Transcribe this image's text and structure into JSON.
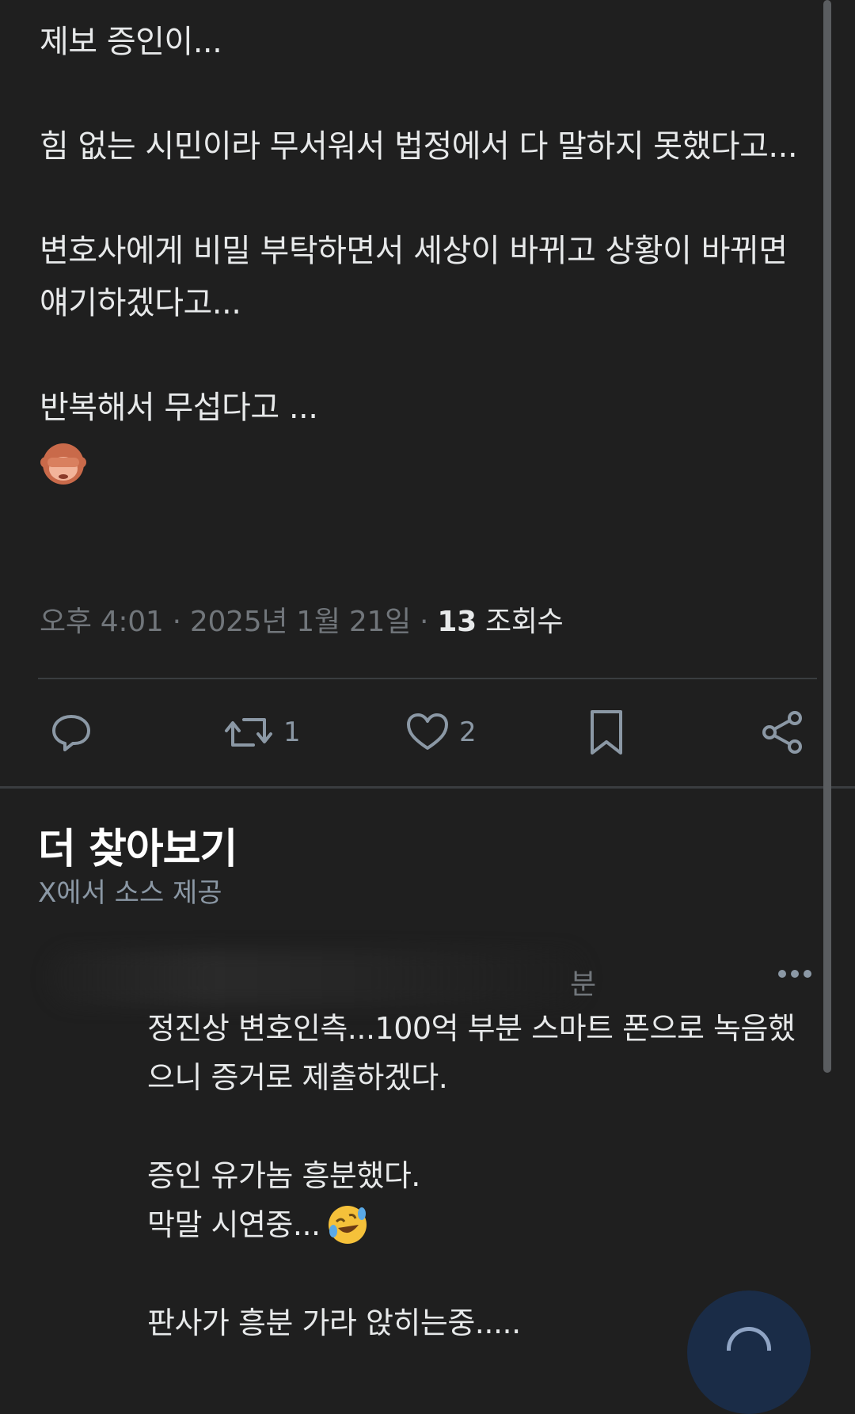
{
  "post": {
    "paragraphs": [
      "제보 증인이...",
      "힘 없는 시민이라 무서워서 법정에서 다 말하지 못했다고...",
      "변호사에게 비밀 부탁하면서 세상이 바뀌고 상황이 바뀌면 얘기하겠다고...",
      "반복해서 무섭다고 ..."
    ],
    "emoji": "see-no-evil-monkey",
    "time": "오후 4:01",
    "separator": "·",
    "date": "2025년 1월 21일",
    "views_count": "13",
    "views_label": "조회수"
  },
  "actions": {
    "reply_icon": "reply-icon",
    "repost_icon": "repost-icon",
    "repost_count": "1",
    "like_icon": "heart-icon",
    "like_count": "2",
    "bookmark_icon": "bookmark-icon",
    "share_icon": "share-icon"
  },
  "discover": {
    "title": "더 찾아보기",
    "subtitle": "X에서 소스 제공"
  },
  "reply_post": {
    "header_suffix": "분",
    "more_icon": "more-dots-icon",
    "lines": [
      "정진상 변호인측...100억 부분 스마트 폰으로 녹음했",
      "으니 증거로 제출하겠다.",
      "",
      "증인 유가놈 흥분했다.",
      "막말 시연중...",
      "",
      "판사가 흥분 가라 앉히는중....."
    ],
    "emoji": "rolling-on-floor-laughing"
  },
  "colors": {
    "background": "#1f1f1f",
    "text": "#e7e9ea",
    "muted": "#71767b",
    "divider": "#3a3d40",
    "fab": "#1a2c47"
  }
}
